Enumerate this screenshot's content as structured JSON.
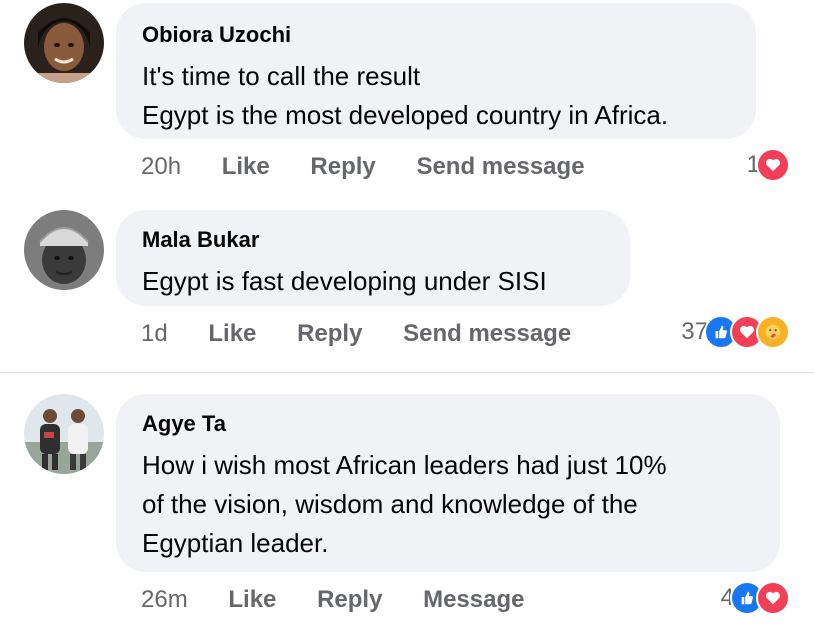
{
  "comments": [
    {
      "author": "Obiora Uzochi",
      "lines": [
        "It's time to call the result",
        "Egypt is the most developed country in Africa."
      ],
      "timestamp": "20h",
      "actions": [
        "Like",
        "Reply",
        "Send message"
      ],
      "reaction_count": "1",
      "reactions": [
        "love-icon"
      ]
    },
    {
      "author": "Mala Bukar",
      "lines": [
        "Egypt is fast developing under SISI"
      ],
      "timestamp": "1d",
      "actions": [
        "Like",
        "Reply",
        "Send message"
      ],
      "reaction_count": "37",
      "reactions": [
        "like-icon",
        "love-icon",
        "care-icon"
      ]
    },
    {
      "author": "Agye Ta",
      "lines": [
        "How i wish most African leaders had just 10%",
        "of the vision, wisdom and knowledge of the",
        "Egyptian leader."
      ],
      "timestamp": "26m",
      "actions": [
        "Like",
        "Reply",
        "Message"
      ],
      "reaction_count": "4",
      "reactions": [
        "like-icon",
        "love-icon"
      ]
    }
  ],
  "colors": {
    "bubble": "#f0f2f5",
    "secondary_text": "#65676b",
    "like": "#1877f2",
    "love": "#f33e58",
    "care": "#f7b125"
  }
}
